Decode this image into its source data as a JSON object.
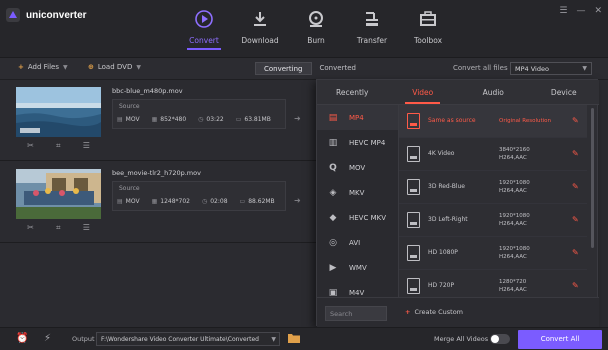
{
  "app": {
    "name": "uniconverter"
  },
  "window_controls": [
    "menu-icon",
    "minimize-icon",
    "close-icon"
  ],
  "nav": {
    "tabs": [
      {
        "label": "Convert",
        "icon": "convert-icon",
        "active": true
      },
      {
        "label": "Download",
        "icon": "download-icon",
        "active": false
      },
      {
        "label": "Burn",
        "icon": "burn-icon",
        "active": false
      },
      {
        "label": "Transfer",
        "icon": "transfer-icon",
        "active": false
      },
      {
        "label": "Toolbox",
        "icon": "toolbox-icon",
        "active": false
      }
    ]
  },
  "toolbar": {
    "add_files": "Add Files",
    "load_dvd": "Load DVD",
    "segments": [
      {
        "label": "Converting",
        "active": true
      },
      {
        "label": "Converted",
        "active": false
      }
    ],
    "convert_all_to_label": "Convert all files to:",
    "convert_all_to_value": "MP4 Video"
  },
  "files": [
    {
      "name": "bbc-blue_m480p.mov",
      "source_label": "Source",
      "container": "MOV",
      "resolution": "852*480",
      "duration": "03:22",
      "size": "63.81MB"
    },
    {
      "name": "bee_movie-tlr2_h720p.mov",
      "source_label": "Source",
      "container": "MOV",
      "resolution": "1248*702",
      "duration": "02:08",
      "size": "88.62MB"
    }
  ],
  "format_panel": {
    "tabs": [
      {
        "label": "Recently",
        "active": false
      },
      {
        "label": "Video",
        "active": true
      },
      {
        "label": "Audio",
        "active": false
      },
      {
        "label": "Device",
        "active": false
      }
    ],
    "formats": [
      {
        "label": "MP4",
        "active": true,
        "icon": "mp4-icon"
      },
      {
        "label": "HEVC MP4",
        "active": false,
        "icon": "hevc-mp4-icon"
      },
      {
        "label": "MOV",
        "active": false,
        "icon": "mov-icon"
      },
      {
        "label": "MKV",
        "active": false,
        "icon": "mkv-icon"
      },
      {
        "label": "HEVC MKV",
        "active": false,
        "icon": "hevc-mkv-icon"
      },
      {
        "label": "AVI",
        "active": false,
        "icon": "avi-icon"
      },
      {
        "label": "WMV",
        "active": false,
        "icon": "wmv-icon"
      },
      {
        "label": "M4V",
        "active": false,
        "icon": "m4v-icon"
      }
    ],
    "resolutions": [
      {
        "name": "Same as source",
        "detail1": "Original Resolution",
        "detail2": "",
        "active": true
      },
      {
        "name": "4K Video",
        "detail1": "3840*2160",
        "detail2": "H264,AAC",
        "active": false
      },
      {
        "name": "3D Red-Blue",
        "detail1": "1920*1080",
        "detail2": "H264,AAC",
        "active": false
      },
      {
        "name": "3D Left-Right",
        "detail1": "1920*1080",
        "detail2": "H264,AAC",
        "active": false
      },
      {
        "name": "HD 1080P",
        "detail1": "1920*1080",
        "detail2": "H264,AAC",
        "active": false
      },
      {
        "name": "HD 720P",
        "detail1": "1280*720",
        "detail2": "H264,AAC",
        "active": false
      }
    ],
    "search_placeholder": "Search",
    "create_custom": "Create Custom"
  },
  "bottom": {
    "output_label": "Output",
    "output_path": "F:\\Wondershare Video Converter Ultimate\\Converted",
    "merge_label": "Merge All Videos",
    "merge_enabled": false,
    "convert_all": "Convert All"
  },
  "colors": {
    "accent": "#7b5cff",
    "highlight": "#ff5a48",
    "background": "#2b2b30"
  }
}
